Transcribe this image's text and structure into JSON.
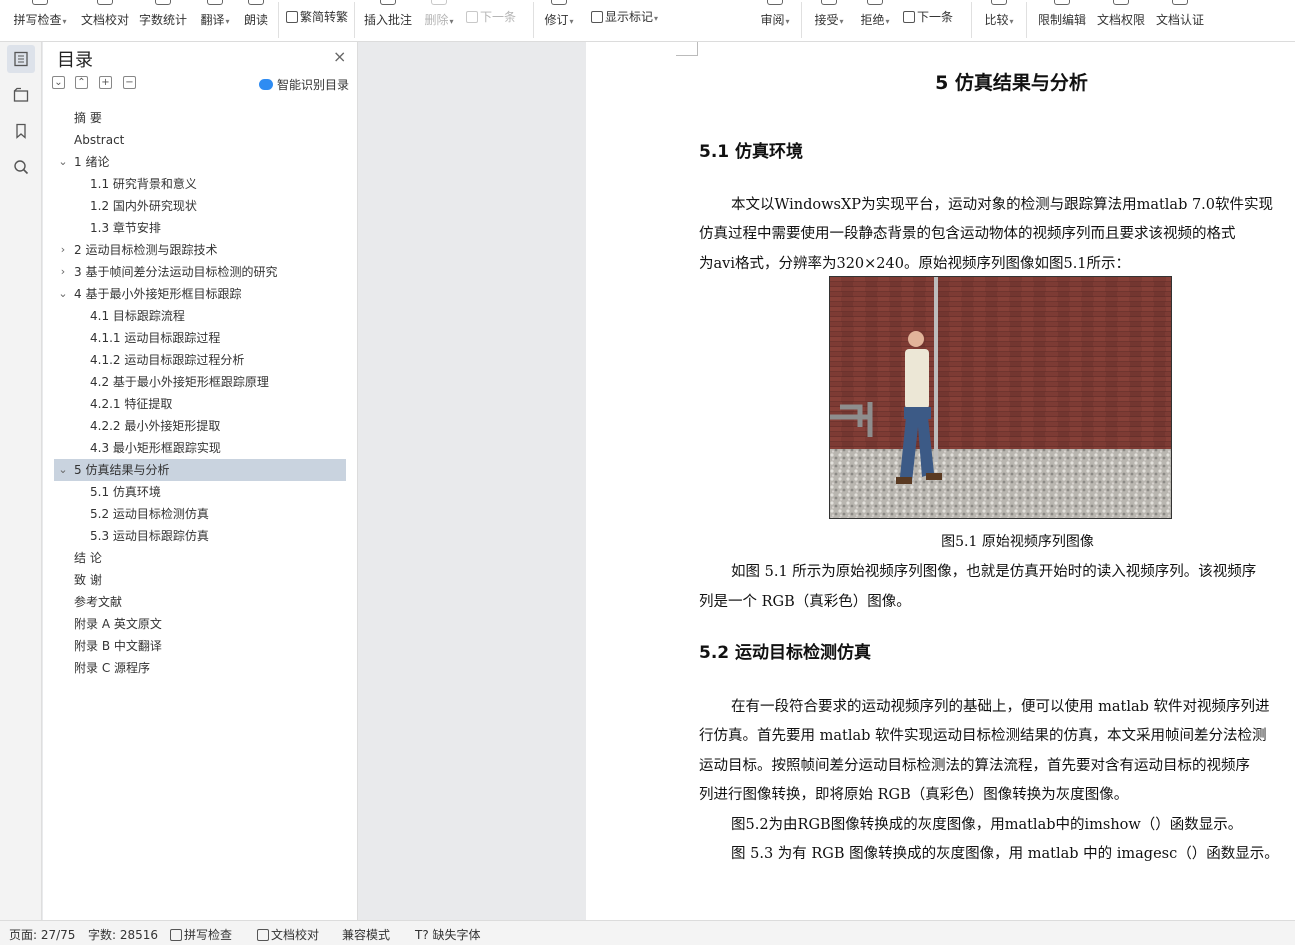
{
  "ribbon": {
    "spell_check": "拼写检查",
    "doc_proof": "文档校对",
    "word_count": "字数统计",
    "translate": "翻译",
    "read_aloud": "朗读",
    "trad_simplified": "繁简转繁",
    "insert_comment": "插入批注",
    "delete": "删除",
    "next_comment": "下一条",
    "track_changes": "修订",
    "show_markup": "显示标记",
    "review": "审阅",
    "accept": "接受",
    "reject": "拒绝",
    "next_change": "下一条",
    "compare": "比较",
    "restrict_edit": "限制编辑",
    "doc_permission": "文档权限",
    "doc_auth": "文档认证"
  },
  "toc": {
    "title": "目录",
    "close": "×",
    "smart_detect": "智能识别目录",
    "items": [
      {
        "text": "摘  要",
        "indent": 0,
        "toggle": ""
      },
      {
        "text": "Abstract",
        "indent": 0,
        "toggle": ""
      },
      {
        "text": "1    绪论",
        "indent": 0,
        "toggle": "v"
      },
      {
        "text": "1.1    研究背景和意义",
        "indent": 1,
        "toggle": ""
      },
      {
        "text": "1.2    国内外研究现状",
        "indent": 1,
        "toggle": ""
      },
      {
        "text": "1.3    章节安排",
        "indent": 1,
        "toggle": ""
      },
      {
        "text": "2    运动目标检测与跟踪技术",
        "indent": 0,
        "toggle": ">"
      },
      {
        "text": "3    基于帧间差分法运动目标检测的研究",
        "indent": 0,
        "toggle": ">"
      },
      {
        "text": "4    基于最小外接矩形框目标跟踪",
        "indent": 0,
        "toggle": "v"
      },
      {
        "text": "4.1    目标跟踪流程",
        "indent": 1,
        "toggle": ""
      },
      {
        "text": "4.1.1    运动目标跟踪过程",
        "indent": 1,
        "toggle": ""
      },
      {
        "text": "4.1.2    运动目标跟踪过程分析",
        "indent": 1,
        "toggle": ""
      },
      {
        "text": "4.2    基于最小外接矩形框跟踪原理",
        "indent": 1,
        "toggle": ""
      },
      {
        "text": "4.2.1    特征提取",
        "indent": 1,
        "toggle": ""
      },
      {
        "text": "4.2.2    最小外接矩形提取",
        "indent": 1,
        "toggle": ""
      },
      {
        "text": "4.3    最小矩形框跟踪实现",
        "indent": 1,
        "toggle": ""
      },
      {
        "text": "5    仿真结果与分析",
        "indent": 0,
        "toggle": "v",
        "selected": true
      },
      {
        "text": "5.1    仿真环境",
        "indent": 1,
        "toggle": ""
      },
      {
        "text": "5.2    运动目标检测仿真",
        "indent": 1,
        "toggle": ""
      },
      {
        "text": "5.3    运动目标跟踪仿真",
        "indent": 1,
        "toggle": ""
      },
      {
        "text": "结  论",
        "indent": 0,
        "toggle": ""
      },
      {
        "text": "致  谢",
        "indent": 0,
        "toggle": ""
      },
      {
        "text": "参考文献",
        "indent": 0,
        "toggle": ""
      },
      {
        "text": "附录 A    英文原文",
        "indent": 0,
        "toggle": ""
      },
      {
        "text": "附录 B    中文翻译",
        "indent": 0,
        "toggle": ""
      },
      {
        "text": "附录 C    源程序",
        "indent": 0,
        "toggle": ""
      }
    ]
  },
  "doc": {
    "chapter": "5    仿真结果与分析",
    "sec1": "5.1    仿真环境",
    "p1_1": "本文以WindowsXP为实现平台，运动对象的检测与跟踪算法用matlab 7.0软件实现",
    "p1_2": "仿真过程中需要使用一段静态背景的包含运动物体的视频序列而且要求该视频的格式",
    "p1_3": "为avi格式，分辨率为320×240。原始视频序列图像如图5.1所示：",
    "fig_caption": "图5.1  原始视频序列图像",
    "p2_1": "如图 5.1 所示为原始视频序列图像，也就是仿真开始时的读入视频序列。该视频序",
    "p2_2": "列是一个 RGB（真彩色）图像。",
    "sec2": "5.2    运动目标检测仿真",
    "p3_1": "在有一段符合要求的运动视频序列的基础上，便可以使用 matlab 软件对视频序列进",
    "p3_2": "行仿真。首先要用 matlab 软件实现运动目标检测结果的仿真，本文采用帧间差分法检测",
    "p3_3": "运动目标。按照帧间差分运动目标检测法的算法流程，首先要对含有运动目标的视频序",
    "p3_4": "列进行图像转换，即将原始 RGB（真彩色）图像转换为灰度图像。",
    "p4": "图5.2为由RGB图像转换成的灰度图像，用matlab中的imshow（）函数显示。",
    "p5": "图 5.3 为有 RGB 图像转换成的灰度图像，用 matlab 中的 imagesc（）函数显示。"
  },
  "status": {
    "page": "页面: 27/75",
    "words": "字数: 28516",
    "spell": "拼写检查",
    "proof": "文档校对",
    "compat": "兼容模式",
    "missing_font": "缺失字体"
  }
}
